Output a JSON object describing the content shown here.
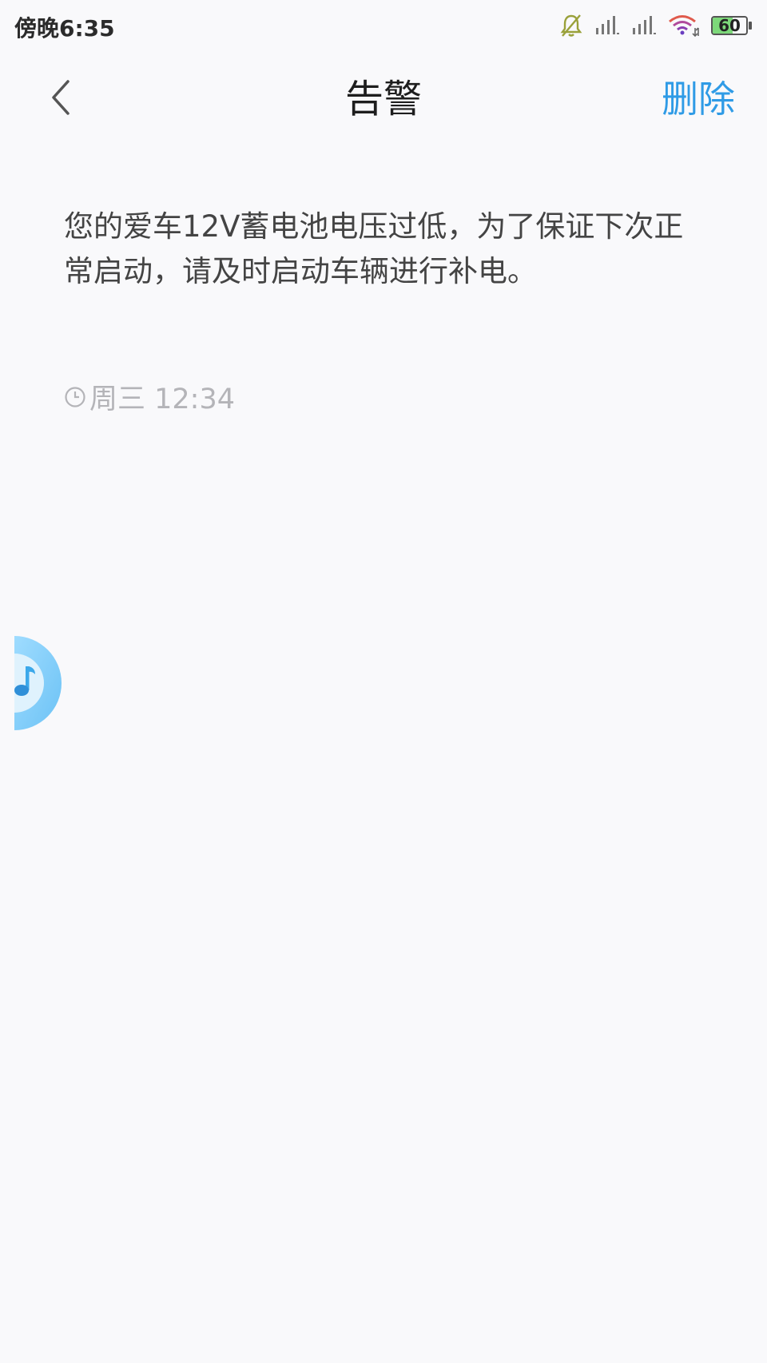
{
  "status_bar": {
    "time": "傍晚6:35",
    "battery_level": 60,
    "icons": [
      "bell-muted-icon",
      "signal-icon",
      "signal-icon",
      "wifi-icon",
      "battery-icon"
    ]
  },
  "nav": {
    "back_icon": "chevron-left-icon",
    "title": "告警",
    "delete_label": "删除"
  },
  "message": {
    "text": "您的爱车12V蓄电池电压过低，为了保证下次正常启动，请及时启动车辆进行补电。",
    "time_icon": "clock-icon",
    "time": "周三 12:34"
  },
  "floating_bubble": {
    "icon": "music-note-icon"
  },
  "colors": {
    "background": "#f9f9fb",
    "accent": "#2f9be6",
    "title": "#1e1e1e",
    "body_text": "#444444",
    "muted_text": "#b4b4b8"
  }
}
